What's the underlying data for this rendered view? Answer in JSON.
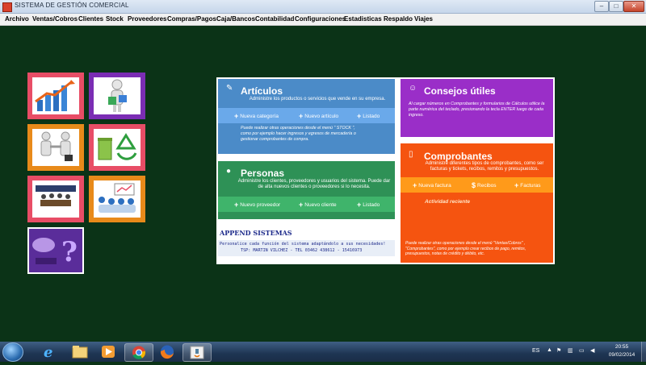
{
  "window": {
    "title": "SISTEMA DE GESTIÓN COMERCIAL",
    "minimize": "–",
    "maximize": "□",
    "close": "✕"
  },
  "menu": [
    "Archivo",
    "Ventas/Cobros",
    "Clientes",
    "Stock",
    "Proveedores",
    "Compras/Pagos",
    "Caja/Bancos",
    "Contabilidad",
    "Configuraciones",
    "Estadisticas",
    "Respaldo",
    "Viajes"
  ],
  "tiles": [
    {
      "icon": "bar-chart-icon",
      "color": "#e84d66"
    },
    {
      "icon": "delivery-person-icon",
      "color": "#7b2db4"
    },
    {
      "icon": "handshake-icon",
      "color": "#e88a1a"
    },
    {
      "icon": "recycle-icon",
      "color": "#e84d66"
    },
    {
      "icon": "meeting-icon",
      "color": "#e84d66"
    },
    {
      "icon": "team-icon",
      "color": "#e88a1a"
    },
    {
      "icon": "question-icon",
      "color": "#ffffff"
    }
  ],
  "articulos": {
    "title": "Artículos",
    "desc": "Administre los productos o servicios que vende en su empresa.",
    "actions": [
      "Nueva categoría",
      "Nuevo artículo",
      "Listado"
    ],
    "note": "Puede realizar otras operaciones desde el menú \" STOCK \", como por ejemplo  hacer ingresos y egresos de mercadería o gestionar comprobantes  de compra."
  },
  "personas": {
    "title": "Personas",
    "desc": "Administre los clientes, proveedores y usuarios del sistema. Puede dar de alta nuevos clientes o proveedores si lo necesita.",
    "actions": [
      "Nuevo proveedor",
      "Nuevo cliente",
      "Listado"
    ]
  },
  "append": {
    "title": "APPEND SISTEMAS",
    "line1": "Personalice cada función del sistema adaptándolo a sus necesidades!",
    "line2": "TSP: MARTIN VILCHEZ - TEL 03462 438612 - 15416973"
  },
  "consejos": {
    "title": "Consejos útiles",
    "text": "Al cargar números en Comprobantes y formularios de Cálculos utilice la parte numérica del teclado, presionando la tecla ENTER luego de cada ingreso."
  },
  "comprobantes": {
    "title": "Comprobantes",
    "desc": "Administre diferentes tipos de comprobantes, como ser facturas y tickets, recibos, remitos y presupuestos.",
    "actions": [
      "Nueva factura",
      "Recibos",
      "Facturas"
    ],
    "actividad": "Actividad reciente",
    "note": "Puede realizar otras operaciones desde el menú \"Ventas/Cobros\" , \"Comprobantes\", como por ejemplo crear recibos de pago, remitos, presupuestos, notas de crédito y débito, etc."
  },
  "taskbar": {
    "lang": "ES",
    "time": "20:55",
    "date": "09/02/2014",
    "apps": [
      "start-orb-icon",
      "internet-explorer-icon",
      "file-explorer-icon",
      "media-player-icon",
      "chrome-icon",
      "firefox-icon",
      "java-app-icon"
    ]
  },
  "colors": {
    "background": "#0b3317",
    "articulos": "#4b8bc8",
    "personas": "#2e9156",
    "consejos": "#9a2ec8",
    "comprobantes": "#f55410"
  }
}
